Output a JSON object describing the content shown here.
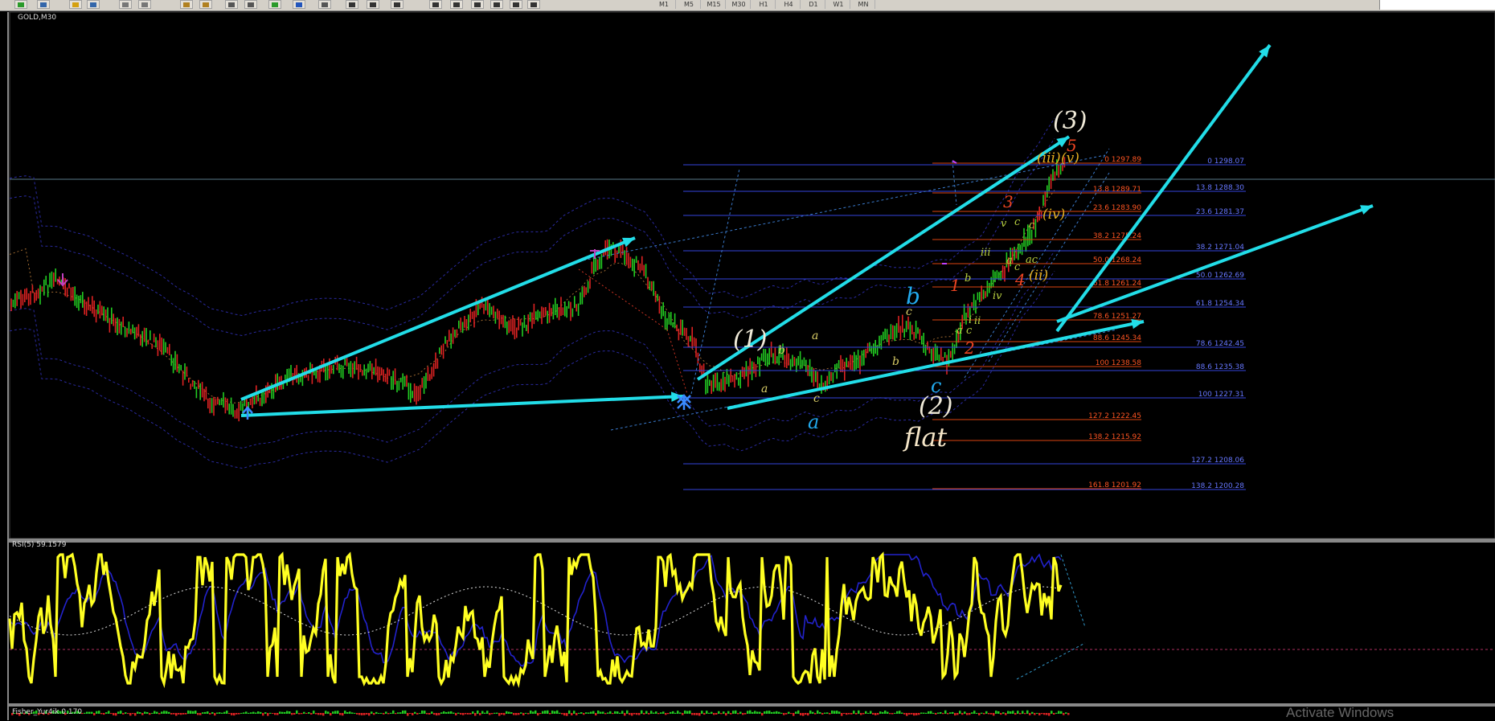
{
  "toolbar": {
    "timeframes": [
      "M1",
      "M5",
      "M15",
      "M30",
      "H1",
      "H4",
      "D1",
      "W1",
      "MN"
    ],
    "icons": [
      "new-chart-icon",
      "profiles-icon",
      "navigator-icon",
      "star-icon",
      "zoom-in-icon",
      "zoom-out-icon",
      "grid-icon",
      "autoscroll-icon",
      "indicator-add-icon",
      "periodicity-icon",
      "template-icon",
      "cursor-icon",
      "crosshair-icon",
      "vertical-line-icon",
      "horizontal-line-icon",
      "trendline-icon",
      "channel-icon",
      "fibonacci-icon",
      "text-icon",
      "text-label-icon",
      "arrow-icon"
    ]
  },
  "chart": {
    "symbol_label": "GOLD,M30",
    "colors": {
      "bg": "#000000",
      "wave_arrow": "#22dde8",
      "fib_blue": "#3344dd",
      "fib_red": "#dd4411",
      "rsi_line": "#ffff22",
      "rsi_blue": "#2222cc"
    },
    "fib_blue_labels": [
      "0 1298.07",
      "13.8 1288.30",
      "23.6 1281.37",
      "38.2 1271.04",
      "50.0 1262.69",
      "61.8 1254.34",
      "78.6 1242.45",
      "88.6 1235.38",
      "100 1227.31",
      "127.2 1208.06",
      "138.2 1200.28"
    ],
    "fib_red_labels": [
      "0 1297.89",
      "13.8 1289.71",
      "23.6 1283.90",
      "38.2 1275.24",
      "50.0 1268.24",
      "61.8 1261.24",
      "78.6 1251.27",
      "88.6 1245.34",
      "100 1238.58",
      "127.2 1222.45",
      "138.2 1215.92",
      "161.8 1201.92"
    ],
    "wave_labels": {
      "w3": "(3)",
      "w1": "(1)",
      "w2": "(2)",
      "flat": "flat",
      "a_big": "a",
      "b_big": "b",
      "c_big": "c",
      "iii": "(iii)",
      "v": "(v)",
      "iv": "(iv)",
      "ii": "(ii)",
      "r1": "1",
      "r2": "2",
      "r3": "3",
      "r4": "4",
      "r5": "5",
      "s_a1": "a",
      "s_b1": "b",
      "s_c1": "c",
      "s_a2": "a",
      "s_b2": "b",
      "s_c2": "c",
      "g_i": "i",
      "g_ii": "ii",
      "g_iii": "iii",
      "g_iv": "iv",
      "g_v": "v",
      "g_a1": "a",
      "g_c1": "c",
      "g_a2": "a",
      "g_c2": "c",
      "g_ac": "ac",
      "g_c3": "c",
      "g_b": "b",
      "g_c4": "c"
    }
  },
  "rsi_panel": {
    "label": "RSI(5) 59.1579"
  },
  "fisher_panel": {
    "label": "Fisher_Yur4ik 0.170"
  },
  "watermark": "Activate Windows"
}
